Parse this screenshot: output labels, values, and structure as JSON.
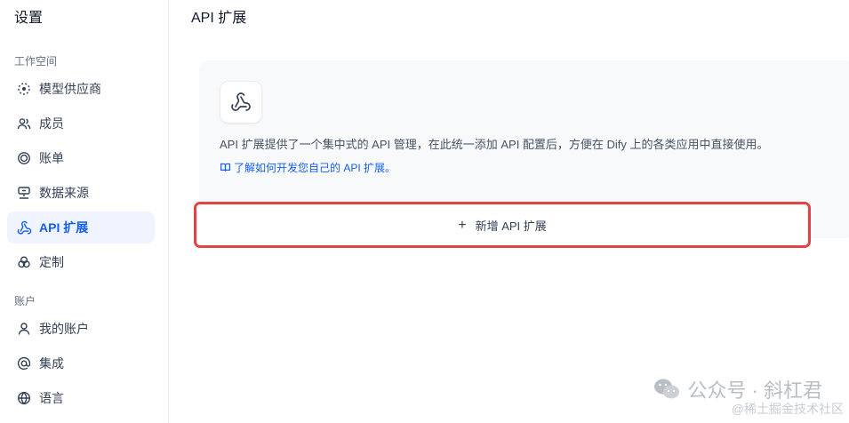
{
  "sidebar": {
    "title": "设置",
    "workspace_label": "工作空间",
    "account_label": "账户",
    "workspace_items": [
      {
        "label": "模型供应商",
        "icon": "model-provider-icon"
      },
      {
        "label": "成员",
        "icon": "members-icon"
      },
      {
        "label": "账单",
        "icon": "billing-icon"
      },
      {
        "label": "数据来源",
        "icon": "data-source-icon"
      },
      {
        "label": "API 扩展",
        "icon": "webhook-icon",
        "active": true
      },
      {
        "label": "定制",
        "icon": "customize-icon"
      }
    ],
    "account_items": [
      {
        "label": "我的账户",
        "icon": "user-icon"
      },
      {
        "label": "集成",
        "icon": "at-icon"
      },
      {
        "label": "语言",
        "icon": "globe-icon"
      }
    ]
  },
  "main": {
    "title": "API 扩展",
    "card": {
      "description": "API 扩展提供了一个集中式的 API 管理，在此统一添加 API 配置后，方便在 Dify 上的各类应用中直接使用。",
      "link": "了解如何开发您自己的 API 扩展。"
    },
    "add_button": "新增 API 扩展"
  },
  "watermark": {
    "line1": "公众号 · 斜杠君",
    "line2": "@稀土掘金技术社区"
  },
  "colors": {
    "accent": "#155eef",
    "active_bg": "#eff4ff",
    "highlight_border": "#e04545",
    "card_bg": "#f8f9fb"
  }
}
